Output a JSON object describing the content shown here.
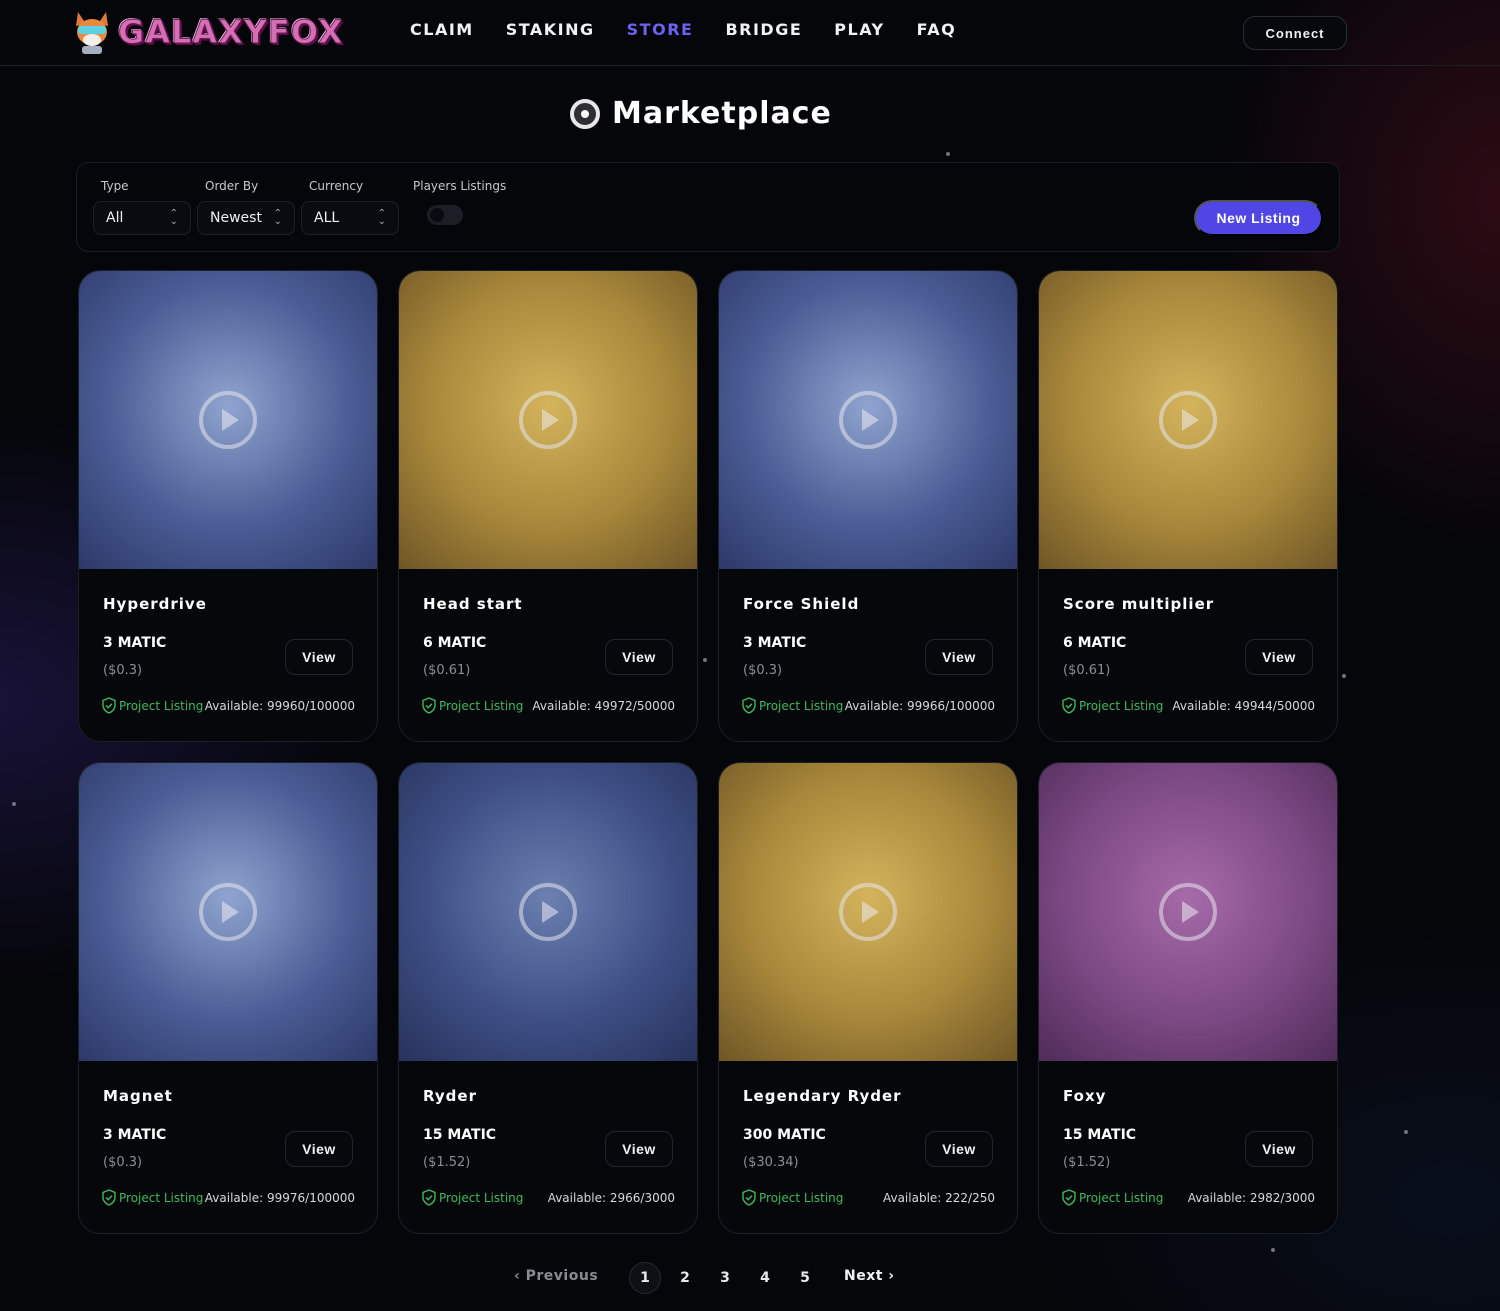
{
  "nav": {
    "logo_text": "GALAXYFOX",
    "links": [
      "CLAIM",
      "STAKING",
      "STORE",
      "BRIDGE",
      "PLAY",
      "FAQ"
    ],
    "active_link": "STORE",
    "connect_label": "Connect"
  },
  "page": {
    "title": "Marketplace"
  },
  "filters": {
    "type": {
      "label": "Type",
      "value": "All"
    },
    "order_by": {
      "label": "Order By",
      "value": "Newest"
    },
    "currency": {
      "label": "Currency",
      "value": "ALL"
    },
    "players_listings": {
      "label": "Players Listings",
      "enabled": false
    },
    "new_listing_label": "New Listing"
  },
  "cards": [
    {
      "name": "Hyperdrive",
      "price": "3 MATIC",
      "usd": "($0.3)",
      "listing": "Project Listing",
      "available": "Available: 99960/100000",
      "view": "View",
      "bg": "blue"
    },
    {
      "name": "Head start",
      "price": "6 MATIC",
      "usd": "($0.61)",
      "listing": "Project Listing",
      "available": "Available: 49972/50000",
      "view": "View",
      "bg": "gold"
    },
    {
      "name": "Force Shield",
      "price": "3 MATIC",
      "usd": "($0.3)",
      "listing": "Project Listing",
      "available": "Available: 99966/100000",
      "view": "View",
      "bg": "blue"
    },
    {
      "name": "Score multiplier",
      "price": "6 MATIC",
      "usd": "($0.61)",
      "listing": "Project Listing",
      "available": "Available: 49944/50000",
      "view": "View",
      "bg": "gold"
    },
    {
      "name": "Magnet",
      "price": "3 MATIC",
      "usd": "($0.3)",
      "listing": "Project Listing",
      "available": "Available: 99976/100000",
      "view": "View",
      "bg": "blue"
    },
    {
      "name": "Ryder",
      "price": "15 MATIC",
      "usd": "($1.52)",
      "listing": "Project Listing",
      "available": "Available: 2966/3000",
      "view": "View",
      "bg": "steel"
    },
    {
      "name": "Legendary Ryder",
      "price": "300 MATIC",
      "usd": "($30.34)",
      "listing": "Project Listing",
      "available": "Available: 222/250",
      "view": "View",
      "bg": "gold"
    },
    {
      "name": "Foxy",
      "price": "15 MATIC",
      "usd": "($1.52)",
      "listing": "Project Listing",
      "available": "Available: 2982/3000",
      "view": "View",
      "bg": "purple"
    }
  ],
  "pagination": {
    "previous_label": "‹  Previous",
    "next_label": "Next  ›",
    "pages": [
      "1",
      "2",
      "3",
      "4",
      "5"
    ],
    "current": "1"
  },
  "colors": {
    "accent": "#4f46e5",
    "active_nav": "#6b63f0",
    "listing_green": "#3fb95c"
  }
}
